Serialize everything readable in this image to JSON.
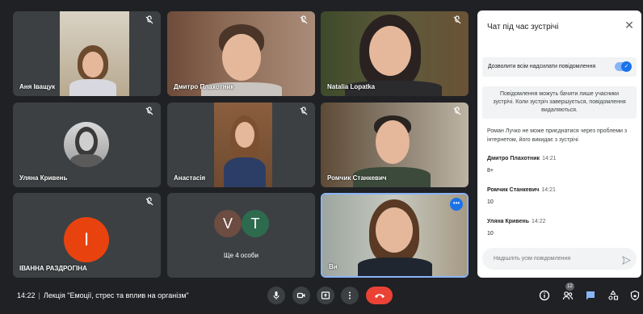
{
  "participants": [
    {
      "name": "Аня Іващук"
    },
    {
      "name": "Дмитро Плахотник"
    },
    {
      "name": "Natalia Lopatka"
    },
    {
      "name": "Уляна Кривень"
    },
    {
      "name": "Анастасія"
    },
    {
      "name": "Ромчик Станкевич"
    },
    {
      "name": "ІВАННА РАЗДРОГІНА",
      "initial": "І",
      "color": "#e8430f"
    },
    {
      "name": "Ще 4 особи",
      "initials": [
        "V",
        "T"
      ],
      "colors": [
        "#6d4c41",
        "#2e6b4e"
      ]
    },
    {
      "name": "Ви"
    }
  ],
  "chat": {
    "title": "Чат під час зустрічі",
    "close_icon": "close-icon",
    "toggle_label": "Дозволити всім надсилати повідомлення",
    "toggle_on": true,
    "notice": "Повідомлення можуть бачити лише учасники зустрічі. Коли зустріч завершується, повідомлення видаляються.",
    "system_message": "Роман Лучко не може приєднатися через проблеми з інтернетом, його викидає з зустрічі",
    "messages": [
      {
        "sender": "Дмитро Плахотник",
        "time": "14:21",
        "text": "8+"
      },
      {
        "sender": "Ромчик Станкевич",
        "time": "14:21",
        "text": "10"
      },
      {
        "sender": "Уляна Кривень",
        "time": "14:22",
        "text": "10"
      }
    ],
    "input_placeholder": "Надішліть усім повідомлення"
  },
  "bottom_bar": {
    "time": "14:22",
    "separator": "|",
    "meeting_title": "Лекція \"Емоції, стрес та вплив на організм\"",
    "participants_count": "12"
  },
  "colors": {
    "background": "#202124",
    "tile": "#3c4043",
    "accent": "#1a73e8",
    "hangup": "#ea4335"
  }
}
